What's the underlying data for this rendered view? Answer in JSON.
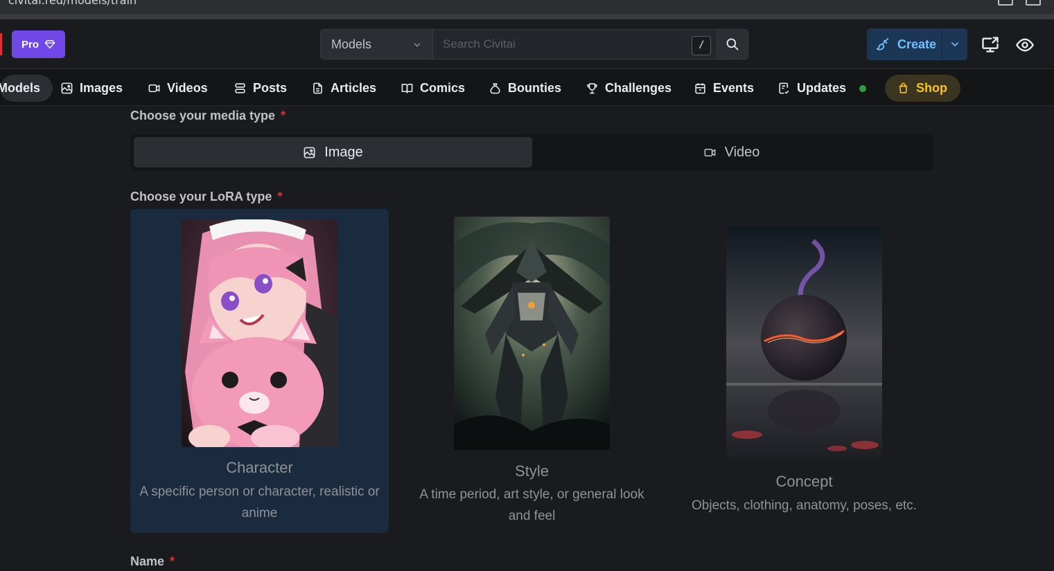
{
  "browser": {
    "url": "civitai.red/models/train"
  },
  "header": {
    "pro_label": "Pro",
    "search_category": "Models",
    "search_placeholder": "Search Civitai",
    "search_shortcut": "/",
    "create_label": "Create"
  },
  "nav": {
    "items": [
      {
        "label": "Models",
        "icon": "models-icon"
      },
      {
        "label": "Images",
        "icon": "image-icon"
      },
      {
        "label": "Videos",
        "icon": "video-icon"
      },
      {
        "label": "Posts",
        "icon": "posts-icon"
      },
      {
        "label": "Articles",
        "icon": "article-icon"
      },
      {
        "label": "Comics",
        "icon": "book-icon"
      },
      {
        "label": "Bounties",
        "icon": "moneybag-icon"
      },
      {
        "label": "Challenges",
        "icon": "trophy-icon"
      },
      {
        "label": "Events",
        "icon": "calendar-icon"
      },
      {
        "label": "Updates",
        "icon": "checklist-icon"
      },
      {
        "label": "Shop",
        "icon": "shopping-bag-icon"
      }
    ]
  },
  "form": {
    "media_type_label": "Choose your media type",
    "media_options": [
      "Image",
      "Video"
    ],
    "media_selected": "Image",
    "lora_type_label": "Choose your LoRA type",
    "lora_types": [
      {
        "title": "Character",
        "desc": "A specific person or character, realistic or anime"
      },
      {
        "title": "Style",
        "desc": "A time period, art style, or general look and feel"
      },
      {
        "title": "Concept",
        "desc": "Objects, clothing, anatomy, poses, etc."
      }
    ],
    "lora_selected": "Character",
    "name_label": "Name",
    "required_mark": "*"
  },
  "colors": {
    "pro": "#7048e8",
    "accent_blue": "#74c0fc",
    "required": "#e03131",
    "shop": "#fcc419",
    "updates_dot": "#2f9e44",
    "selected_card": "#1a2a3f"
  }
}
